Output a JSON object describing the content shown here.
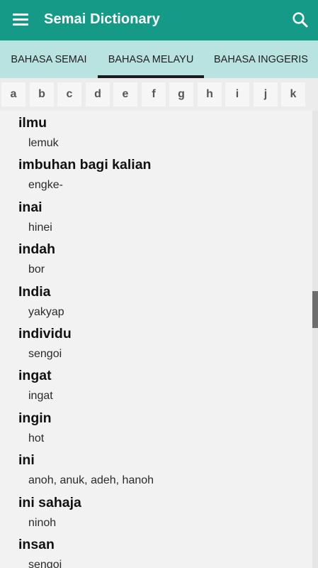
{
  "app": {
    "title": "Semai Dictionary"
  },
  "tabs": [
    {
      "label": "BAHASA SEMAI"
    },
    {
      "label": "BAHASA MELAYU"
    },
    {
      "label": "BAHASA INGGERIS"
    }
  ],
  "selected_tab": "BAHASA MELAYU",
  "alphabet": [
    "a",
    "b",
    "c",
    "d",
    "e",
    "f",
    "g",
    "h",
    "i",
    "j",
    "k"
  ],
  "entries": [
    {
      "word": "ilmu",
      "meaning": "lemuk"
    },
    {
      "word": "imbuhan bagi kalian",
      "meaning": "engke-"
    },
    {
      "word": "inai",
      "meaning": "hinei"
    },
    {
      "word": "indah",
      "meaning": "bor"
    },
    {
      "word": "India",
      "meaning": "yakyap"
    },
    {
      "word": "individu",
      "meaning": "sengoi"
    },
    {
      "word": "ingat",
      "meaning": "ingat"
    },
    {
      "word": "ingin",
      "meaning": "hot"
    },
    {
      "word": "ini",
      "meaning": "anoh, anuk, adeh, hanoh"
    },
    {
      "word": "ini sahaja",
      "meaning": "ninoh"
    },
    {
      "word": "insan",
      "meaning": "sengoi"
    }
  ],
  "colors": {
    "appbar": "#169a88",
    "tabbar": "#b9e3e1",
    "indicator": "#1b1b1b"
  },
  "icons": {
    "menu": "menu-icon",
    "search": "search-icon"
  }
}
